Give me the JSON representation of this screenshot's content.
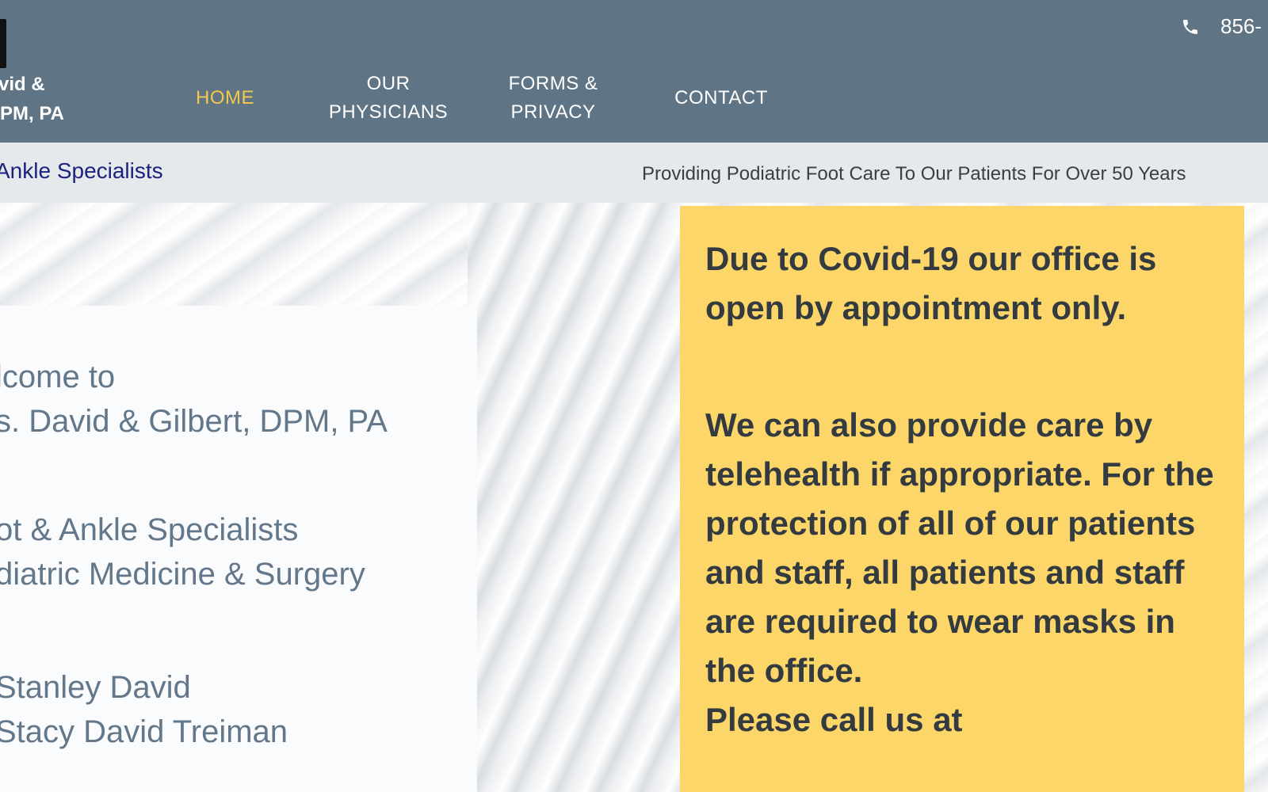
{
  "header": {
    "brand_lines": [
      "vid &",
      "PM, PA"
    ],
    "phone": "856-",
    "nav": [
      {
        "label": "HOME",
        "active": true
      },
      {
        "label": "OUR PHYSICIANS"
      },
      {
        "label": "FORMS & PRIVACY"
      },
      {
        "label": "CONTACT"
      }
    ],
    "accent_color": "#f2c94c",
    "background_color": "#5f7585"
  },
  "tagline": {
    "left": "Ankle Specialists",
    "right": "Providing Podiatric Foot Care To Our Patients For Over 50 Years"
  },
  "welcome": {
    "line1": "lcome to",
    "line2": "s. David & Gilbert, DPM, PA",
    "line3": "ot & Ankle Specialists",
    "line4": "diatric Medicine & Surgery",
    "line5": "Stanley David",
    "line6": "Stacy David Treiman"
  },
  "covid": {
    "p1": "Due to Covid-19 our office is open by appointment only.",
    "p2": "We can also provide care by telehealth if appropriate. For the protection of all of our patients and staff, all patients and staff are required to wear masks in the office.",
    "p3": "Please call us at",
    "background_color": "#fdd669"
  }
}
